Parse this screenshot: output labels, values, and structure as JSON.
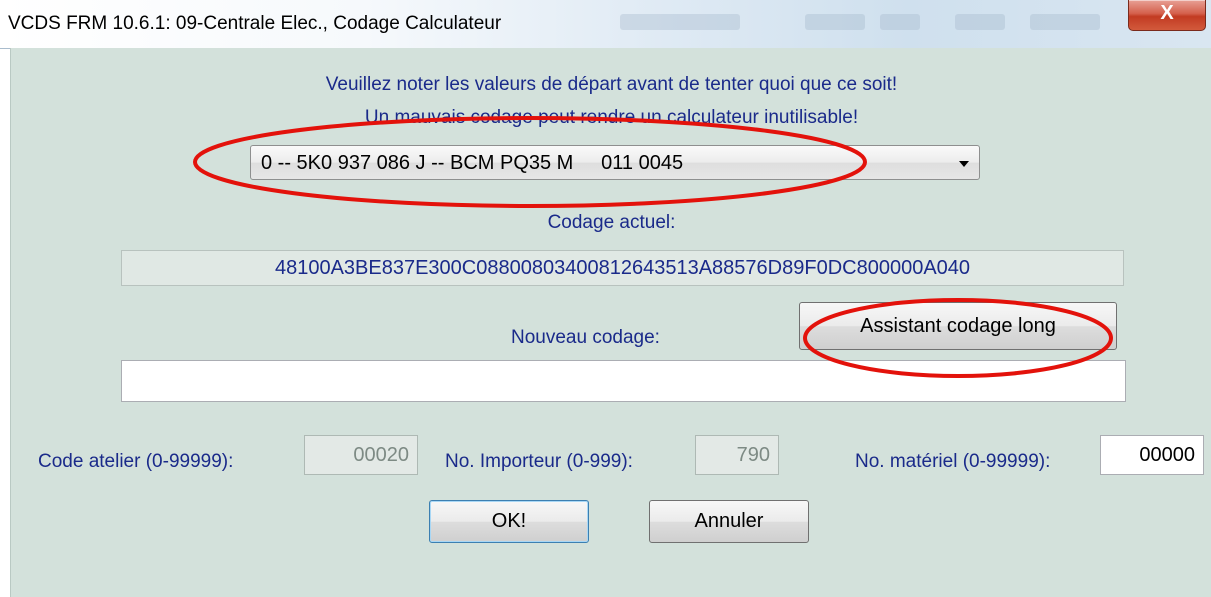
{
  "window": {
    "title": "VCDS FRM 10.6.1: 09-Centrale Elec.,  Codage Calculateur",
    "close_icon": "x-close-icon",
    "close_glyph": "X"
  },
  "dialog": {
    "warning_line1": "Veuillez noter les valeurs de départ avant de tenter quoi que ce soit!",
    "warning_line2": "Un mauvais codage peut rendre un calculateur inutilisable!",
    "module_select": {
      "selected": "0 -- 5K0 937 086 J -- BCM PQ35 M     011 0045",
      "arrow_icon": "dropdown-arrow-icon"
    },
    "current_coding_label": "Codage actuel:",
    "current_coding_value": "48100A3BE837E300C08800803400812643513A88576D89F0DC800000A040",
    "new_coding_label": "Nouveau codage:",
    "long_coding_assistant_label": "Assistant codage long",
    "new_coding_value": "",
    "workshop_code_label": "Code atelier (0-99999):",
    "workshop_code_value": "00020",
    "importer_no_label": "No. Importeur (0-999):",
    "importer_no_value": "790",
    "equipment_no_label": "No. matériel (0-99999):",
    "equipment_no_value": "00000",
    "ok_label": "OK!",
    "cancel_label": "Annuler"
  },
  "colors": {
    "dialog_background": "#d3e1db",
    "label_text": "#1a2a8a",
    "annotation_red": "#e3120b"
  }
}
